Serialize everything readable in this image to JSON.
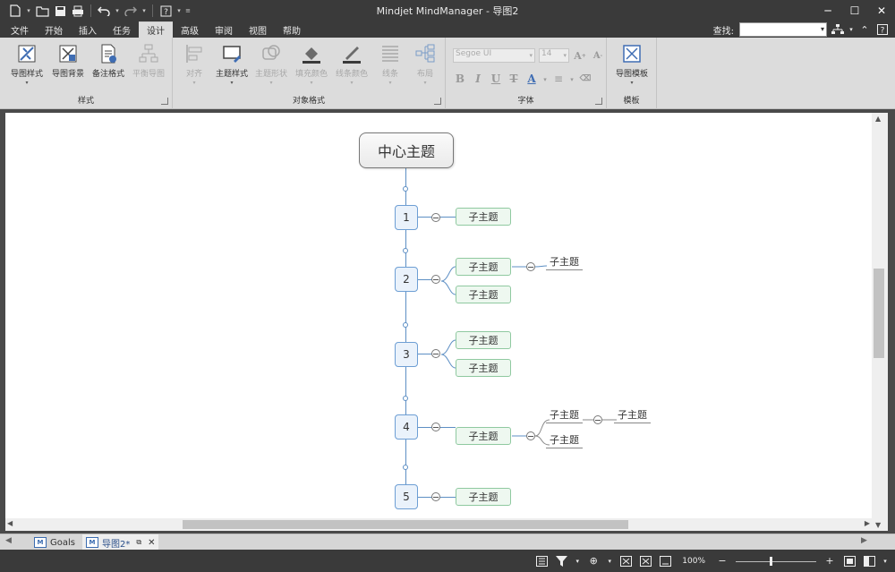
{
  "window": {
    "title": "Mindjet MindManager - 导图2"
  },
  "menu": {
    "tabs": [
      "文件",
      "开始",
      "插入",
      "任务",
      "设计",
      "高级",
      "审阅",
      "视图",
      "帮助"
    ],
    "active": "设计"
  },
  "search": {
    "label": "查找:",
    "value": ""
  },
  "ribbon": {
    "style_group": {
      "label": "样式",
      "buttons": [
        {
          "label": "导图样式",
          "disabled": false
        },
        {
          "label": "导图背景",
          "disabled": false
        },
        {
          "label": "备注格式",
          "disabled": false
        },
        {
          "label": "平衡导图",
          "disabled": true
        }
      ]
    },
    "object_group": {
      "label": "对象格式",
      "buttons": [
        {
          "label": "对齐",
          "disabled": true
        },
        {
          "label": "主题样式",
          "disabled": false
        },
        {
          "label": "主题形状",
          "disabled": true
        },
        {
          "label": "填充颜色",
          "disabled": true
        },
        {
          "label": "线条颜色",
          "disabled": true
        },
        {
          "label": "线条",
          "disabled": true
        },
        {
          "label": "布局",
          "disabled": true
        }
      ]
    },
    "font_group": {
      "label": "字体",
      "font_name": "Segoe UI",
      "font_size": "14"
    },
    "template_group": {
      "label": "模板",
      "button": "导图模板"
    }
  },
  "map": {
    "central": "中心主题",
    "numbers": [
      "1",
      "2",
      "3",
      "4",
      "5"
    ],
    "subtopic": "子主题",
    "floating": [
      "子主题",
      "子主题",
      "子主题",
      "子主题"
    ]
  },
  "doctabs": [
    {
      "label": "Goals",
      "active": false
    },
    {
      "label": "导图2*",
      "active": true
    }
  ],
  "status": {
    "zoom": "100%"
  },
  "colors": {
    "accent": "#5d8fc4",
    "subtopic_border": "#8fc9a0",
    "subtopic_fill": "#eef8f0",
    "ribbon_bg": "#dcdcdc",
    "frame_bg": "#3a3a3a"
  }
}
